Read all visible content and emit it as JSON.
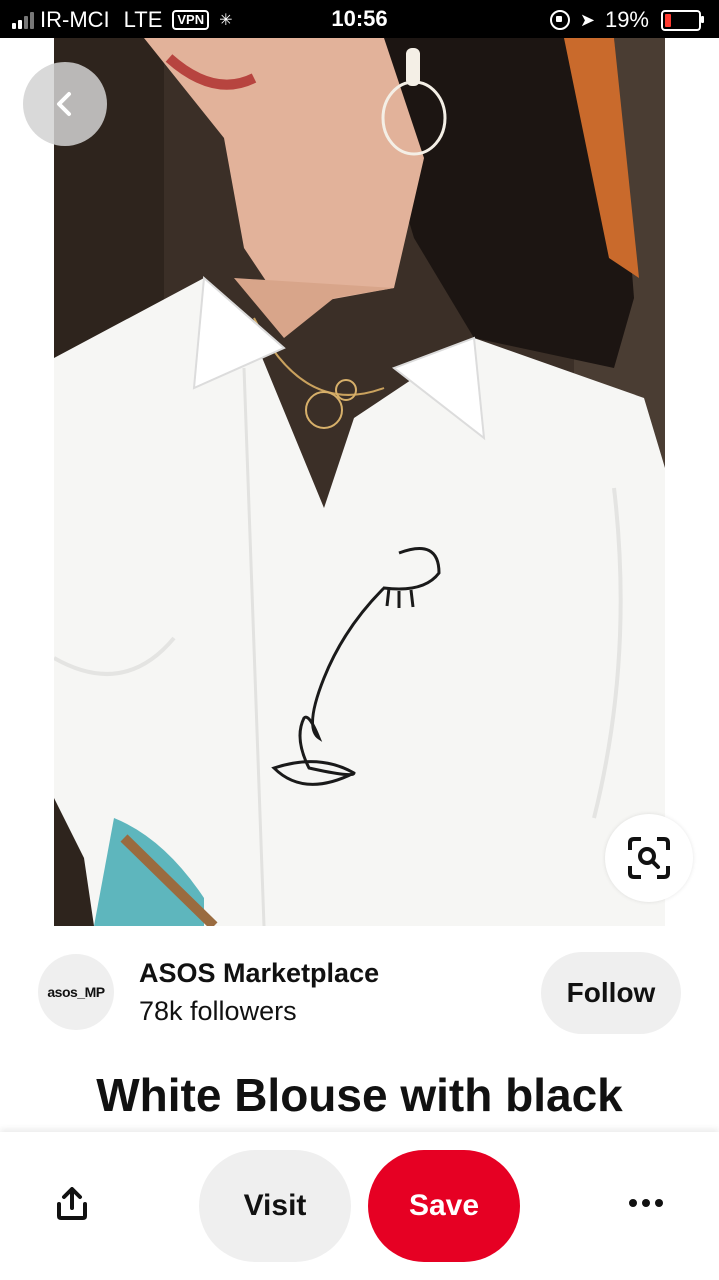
{
  "status_bar": {
    "carrier": "IR-MCI",
    "network": "LTE",
    "vpn": "VPN",
    "time": "10:56",
    "battery": "19%",
    "battery_level": 0.19,
    "battery_color": "#ff3b30",
    "icons": [
      "signal-icon",
      "activity-spinner-icon",
      "rotation-lock-icon",
      "location-arrow-icon",
      "battery-icon"
    ]
  },
  "pin": {
    "image_alt": "Woman wearing a white blouse with a black line-art face embroidery",
    "title": "White Blouse with black"
  },
  "creator": {
    "avatar_text": "asos_MP",
    "name": "ASOS Marketplace",
    "followers": "78k followers",
    "follow_label": "Follow"
  },
  "actions": {
    "visit_label": "Visit",
    "save_label": "Save",
    "icons": [
      "back-chevron-icon",
      "visual-search-icon",
      "share-icon",
      "more-icon"
    ]
  },
  "colors": {
    "save": "#e60023",
    "pill_bg": "#efefef",
    "text": "#111111"
  }
}
